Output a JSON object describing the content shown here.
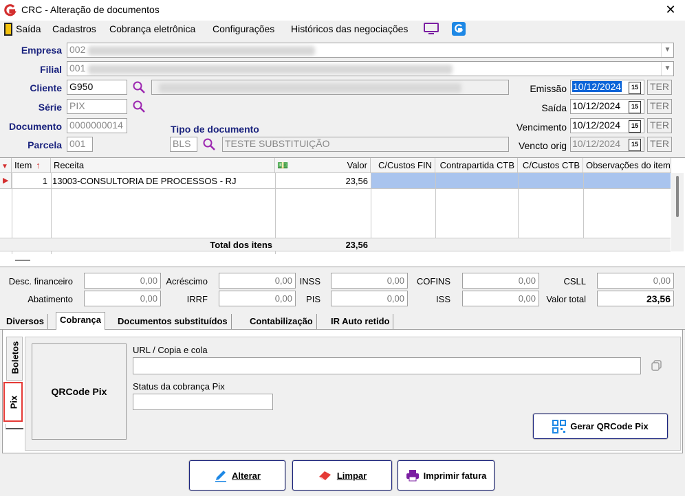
{
  "window": {
    "title": "CRC - Alteração de documentos",
    "close": "✕"
  },
  "menu": [
    "Saída",
    "Cadastros",
    "Cobrança eletrônica",
    "Configurações",
    "Históricos das negociações"
  ],
  "header": {
    "empresa_label": "Empresa",
    "empresa_value": "002",
    "filial_label": "Filial",
    "filial_value": "001",
    "cliente_label": "Cliente",
    "cliente_value": "G950",
    "serie_label": "Série",
    "serie_value": "PIX",
    "documento_label": "Documento",
    "documento_value": "0000000014",
    "parcela_label": "Parcela",
    "parcela_value": "001",
    "tipo_label": "Tipo de documento",
    "tipo_code": "BLS",
    "tipo_desc": "TESTE SUBSTITUIÇÃO",
    "emissao_label": "Emissão",
    "emissao_value": "10/12/2024",
    "emissao_day": "TER",
    "saida_label": "Saída",
    "saida_value": "10/12/2024",
    "saida_day": "TER",
    "vencimento_label": "Vencimento",
    "vencimento_value": "10/12/2024",
    "vencimento_day": "TER",
    "vencto_orig_label": "Vencto orig",
    "vencto_orig_value": "10/12/2024",
    "vencto_orig_day": "TER",
    "cal_glyph": "15"
  },
  "grid": {
    "headers": {
      "item": "Item",
      "receita": "Receita",
      "valor": "Valor",
      "cc_fin": "C/Custos FIN",
      "contrapartida": "Contrapartida CTB",
      "cc_ctb": "C/Custos CTB",
      "obs": "Observações do item"
    },
    "row": {
      "item": "1",
      "receita": "13003-CONSULTORIA DE PROCESSOS - RJ",
      "valor": "23,56"
    },
    "total_label": "Total dos itens",
    "total_value": "23,56"
  },
  "totals": {
    "desc_fin_label": "Desc. financeiro",
    "desc_fin": "0,00",
    "acrescimo_label": "Acréscimo",
    "acrescimo": "0,00",
    "inss_label": "INSS",
    "inss": "0,00",
    "cofins_label": "COFINS",
    "cofins": "0,00",
    "csll_label": "CSLL",
    "csll": "0,00",
    "abatimento_label": "Abatimento",
    "abatimento": "0,00",
    "irrf_label": "IRRF",
    "irrf": "0,00",
    "pis_label": "PIS",
    "pis": "0,00",
    "iss_label": "ISS",
    "iss": "0,00",
    "valor_total_label": "Valor total",
    "valor_total": "23,56"
  },
  "tabs": [
    "Diversos",
    "Cobrança",
    "Documentos substituídos",
    "Contabilização",
    "IR Auto retido"
  ],
  "side_tabs": [
    "Boletos",
    "Pix"
  ],
  "pix": {
    "qrcode_label": "QRCode Pix",
    "url_label": "URL / Copia e cola",
    "url_value": "",
    "status_label": "Status da cobrança Pix",
    "status_value": "",
    "gerar_button": "Gerar QRCode Pix"
  },
  "buttons": {
    "alterar": "Alterar",
    "limpar": "Limpar",
    "imprimir": "Imprimir fatura"
  },
  "colors": {
    "accent": "#1a237e",
    "selection": "#a9c4ee",
    "brand": "#d32f2f"
  }
}
